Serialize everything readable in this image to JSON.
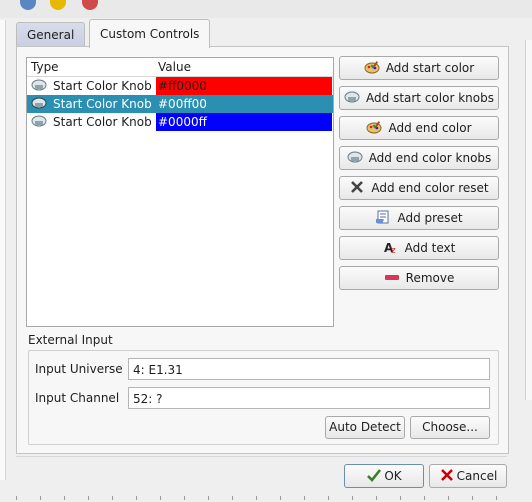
{
  "tabs": [
    {
      "label": "General",
      "active": false
    },
    {
      "label": "Custom Controls",
      "active": true
    }
  ],
  "controls_list": {
    "columns": [
      "Type",
      "Value"
    ],
    "rows": [
      {
        "type": "Start Color Knob",
        "value": "#ff0000",
        "color": "#ff0000",
        "selected": false
      },
      {
        "type": "Start Color Knob",
        "value": "#00ff00",
        "color": "#00ff00",
        "selected": true
      },
      {
        "type": "Start Color Knob",
        "value": "#0000ff",
        "color": "#0000ff",
        "selected": false
      }
    ]
  },
  "actions": [
    {
      "label": "Add start color",
      "icon": "palette-icon"
    },
    {
      "label": "Add start color knobs",
      "icon": "knob-icon"
    },
    {
      "label": "Add end color",
      "icon": "palette-icon"
    },
    {
      "label": "Add end color knobs",
      "icon": "knob-icon"
    },
    {
      "label": "Add end color reset",
      "icon": "x-icon"
    },
    {
      "label": "Add preset",
      "icon": "preset-icon"
    },
    {
      "label": "Add text",
      "icon": "text-icon"
    },
    {
      "label": "Remove",
      "icon": "minus-icon"
    }
  ],
  "external_input": {
    "title": "External Input",
    "universe_label": "Input Universe",
    "universe_value": "4: E1.31",
    "channel_label": "Input Channel",
    "channel_value": "52: ?",
    "auto_detect": "Auto Detect",
    "choose": "Choose..."
  },
  "footer": {
    "ok": "OK",
    "cancel": "Cancel"
  },
  "colors": {
    "selection": "#2a8fb0",
    "accent_cancel": "#cc0000",
    "accent_ok": "#3a7d2b"
  }
}
